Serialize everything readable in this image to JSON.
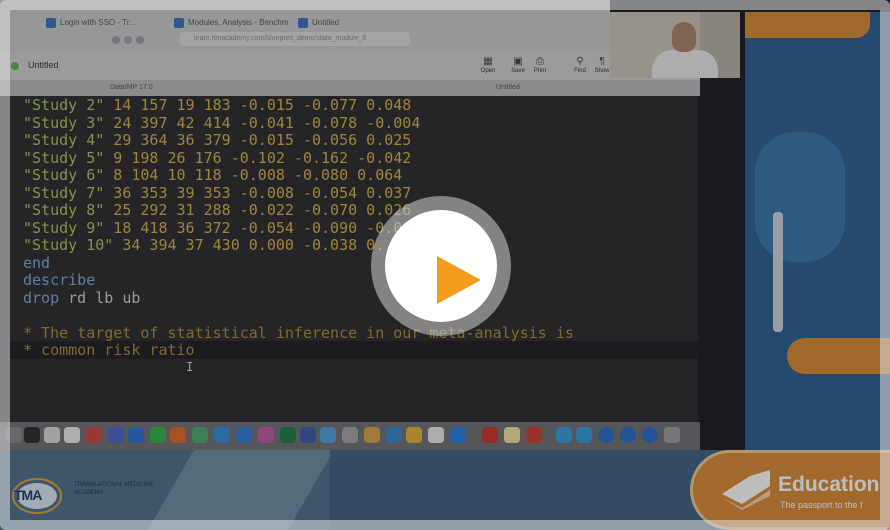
{
  "browser": {
    "tabs": [
      {
        "label": "Login with SSO - Tr..."
      },
      {
        "label": "Modules, Analysis - Benchm..."
      },
      {
        "label": "Untitled"
      }
    ],
    "address": "learn.ttmacademy.com/blueprint_demo/stata_module_8"
  },
  "app": {
    "window_title": "Untitled",
    "toolbar": [
      {
        "label": "Open",
        "icon": "folder-icon"
      },
      {
        "label": "Save",
        "icon": "save-icon"
      },
      {
        "label": "Print",
        "icon": "print-icon"
      },
      {
        "label": "Find",
        "icon": "search-icon"
      },
      {
        "label": "Show",
        "icon": "paragraph-icon"
      }
    ],
    "subwindow_title_left": "Data/MP 17.0",
    "subwindow_title_center": "Untitled"
  },
  "editor": {
    "lines": [
      {
        "str": "\"Study 2\"",
        "rest": " 14 157 19 183 -0.015 -0.077 0.048"
      },
      {
        "str": "\"Study 3\"",
        "rest": " 24 397 42 414 -0.041 -0.078 -0.004"
      },
      {
        "str": "\"Study 4\"",
        "rest": " 29 364 36 379 -0.015 -0.056 0.025"
      },
      {
        "str": "\"Study 5\"",
        "rest": " 9 198 26 176 -0.102 -0.162 -0.042"
      },
      {
        "str": "\"Study 6\"",
        "rest": " 8 104 10 118 -0.008 -0.080 0.064"
      },
      {
        "str": "\"Study 7\"",
        "rest": " 36 353 39 353 -0.008 -0.054 0.037"
      },
      {
        "str": "\"Study 8\"",
        "rest": " 25 292 31 288 -0.022 -0.070 0.026"
      },
      {
        "str": "\"Study 9\"",
        "rest": " 18 418 36 372 -0.054 -0.090 -0.0"
      },
      {
        "str": "\"Study 10\"",
        "rest": " 34 394 37 430 0.000 -0.038 0."
      }
    ],
    "end": "end",
    "describe": "describe",
    "drop_kw": "drop",
    "drop_args": " rd lb ub",
    "comment1": "* The target of statistical inference in our meta-analysis is",
    "comment2": "* common risk ratio"
  },
  "footer": {
    "logo_text": "TMA",
    "academy_name": "TRANSLATIONAL MEDICINE ACADEMY",
    "education_title": "Education",
    "education_tagline": "The passport to the f"
  },
  "video": {
    "play_icon": "play-icon",
    "accent": "#f29b1d"
  }
}
